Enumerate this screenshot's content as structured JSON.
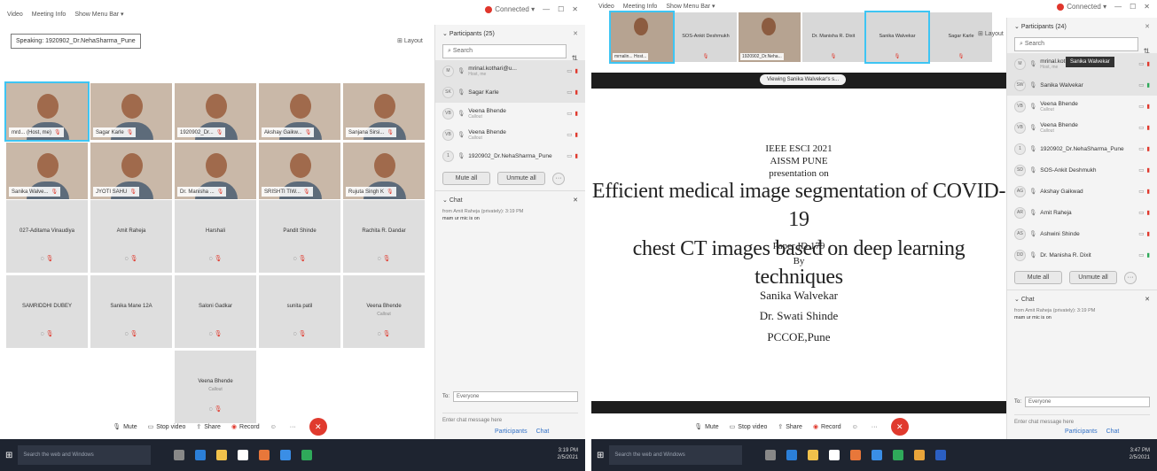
{
  "left": {
    "titlebar": {
      "items": [
        "Video",
        "Meeting Info",
        "Show Menu Bar ▾"
      ]
    },
    "window": {
      "status": "Connected ▾",
      "minimize": "—",
      "maximize": "☐",
      "close": "✕"
    },
    "speaking": "Speaking: 1920902_Dr.NehaSharma_Pune",
    "layout": "Layout",
    "video_tiles": [
      {
        "name": "mrd... (Host, me)",
        "active": true
      },
      {
        "name": "Sagar Karle"
      },
      {
        "name": "1920902_Dr..."
      },
      {
        "name": "Akshay Gaikw..."
      },
      {
        "name": "Sanjana Sirsi..."
      },
      {
        "name": "Sanika Walve..."
      },
      {
        "name": "JYOTI SAHU"
      },
      {
        "name": "Dr. Manisha ..."
      },
      {
        "name": "SRISHTI TIW..."
      },
      {
        "name": "Rujuta Singh K"
      }
    ],
    "audio_tiles": [
      {
        "name": "027-Aditama Vinaudiya",
        "sub": ""
      },
      {
        "name": "Amit Raheja",
        "sub": ""
      },
      {
        "name": "Harshali",
        "sub": ""
      },
      {
        "name": "Pandit Shinde",
        "sub": ""
      },
      {
        "name": "Rachita R. Dandar",
        "sub": ""
      },
      {
        "name": "SAMRIDDHI DUBEY",
        "sub": ""
      },
      {
        "name": "Sanika Mane 12A",
        "sub": ""
      },
      {
        "name": "Saloni Gadkar",
        "sub": ""
      },
      {
        "name": "sunita patil",
        "sub": ""
      },
      {
        "name": "Veena Bhende",
        "sub": "Callout"
      },
      {
        "name": "",
        "sub": ""
      },
      {
        "name": "",
        "sub": ""
      },
      {
        "name": "Veena Bhende",
        "sub": "Callout"
      }
    ],
    "panel": {
      "title": "Participants (25)",
      "search_placeholder": "Search",
      "rows": [
        {
          "initials": "M",
          "name": "mrinal.kothari@u...",
          "sub": "Host, me"
        },
        {
          "initials": "SK",
          "name": "Sagar Karle",
          "sub": ""
        },
        {
          "initials": "VB",
          "name": "Veena Bhende",
          "sub": "Callout"
        },
        {
          "initials": "VB",
          "name": "Veena Bhende",
          "sub": "Callout"
        },
        {
          "initials": "1",
          "name": "1920902_Dr.NehaSharma_Pune",
          "sub": ""
        }
      ],
      "mute_all": "Mute all",
      "unmute_all": "Unmute all",
      "more": "···"
    },
    "chat": {
      "title": "Chat",
      "from": "from Amit Raheja (privately): 3:19 PM",
      "text": "mam ur mic is on",
      "to_label": "To:",
      "to_value": "Everyone",
      "placeholder": "Enter chat message here"
    },
    "toolbar": {
      "mute": "Mute",
      "video": "Stop video",
      "share": "Share",
      "record": "Record",
      "participants": "Participants",
      "chat": "Chat"
    },
    "taskbar": {
      "search": "Search the web and Windows",
      "time": "3:19 PM",
      "date": "2/5/2021"
    }
  },
  "right": {
    "titlebar": {
      "items": [
        "Video",
        "Meeting Info",
        "Show Menu Bar ▾"
      ]
    },
    "window": {
      "status": "Connected ▾",
      "minimize": "—",
      "maximize": "☐",
      "close": "✕"
    },
    "thumbs": [
      {
        "name": "mrnalin... Host...",
        "video": true,
        "active": true
      },
      {
        "name": "SOS-Ankit Deshmukh",
        "video": false
      },
      {
        "name": "1920902_Dr.Neha...",
        "video": true
      },
      {
        "name": "Dr. Manisha R. Dixit",
        "video": false
      },
      {
        "name": "Sanika Walvekar",
        "video": false,
        "active": true
      },
      {
        "name": "Sagar Karle",
        "video": false
      }
    ],
    "layout": "Layout",
    "viewing": "Viewing Sanika Walvekar's s...",
    "slide": {
      "lines_top": [
        "IEEE ESCI 2021",
        "AISSM PUNE",
        "presentation on"
      ],
      "title_lines": [
        "Efficient medical image segmentation of COVID-19",
        "chest CT images based on deep learning techniques"
      ],
      "lines_mid": [
        "Paper ID 179",
        "By"
      ],
      "lines_bottom": [
        "Sanika Walvekar",
        "Dr. Swati Shinde",
        "PCCOE,Pune"
      ]
    },
    "panel": {
      "title": "Participants (24)",
      "search_placeholder": "Search",
      "tooltip": "Sanika Walvekar",
      "rows": [
        {
          "initials": "M",
          "name": "mrinal.kothari...",
          "sub": "Host, me",
          "status": ""
        },
        {
          "initials": "SW",
          "name": "Sanika Walvekar",
          "sub": "",
          "status": "green"
        },
        {
          "initials": "VB",
          "name": "Veena Bhende",
          "sub": "Callout",
          "status": "red"
        },
        {
          "initials": "VB",
          "name": "Veena Bhende",
          "sub": "Callout",
          "status": "red"
        },
        {
          "initials": "1",
          "name": "1920902_Dr.NehaSharma_Pune",
          "sub": "",
          "status": ""
        },
        {
          "initials": "SD",
          "name": "SOS-Ankit Deshmukh",
          "sub": "",
          "status": "red"
        },
        {
          "initials": "AG",
          "name": "Akshay Gaikwad",
          "sub": "",
          "status": "red"
        },
        {
          "initials": "AR",
          "name": "Amit Raheja",
          "sub": "",
          "status": "red"
        },
        {
          "initials": "AS",
          "name": "Ashwini Shinde",
          "sub": "",
          "status": "red"
        },
        {
          "initials": "DD",
          "name": "Dr. Manisha R. Dixit",
          "sub": "",
          "status": "green"
        }
      ],
      "mute_all": "Mute all",
      "unmute_all": "Unmute all",
      "more": "···"
    },
    "chat": {
      "title": "Chat",
      "from": "from Amit Raheja (privately): 3:19 PM",
      "text": "mam ur mic is on",
      "to_label": "To:",
      "to_value": "Everyone",
      "placeholder": "Enter chat message here"
    },
    "toolbar": {
      "mute": "Mute",
      "video": "Stop video",
      "share": "Share",
      "record": "Record",
      "participants": "Participants",
      "chat": "Chat"
    },
    "taskbar": {
      "search": "Search the web and Windows",
      "time": "3:47 PM",
      "date": "2/5/2021"
    }
  }
}
